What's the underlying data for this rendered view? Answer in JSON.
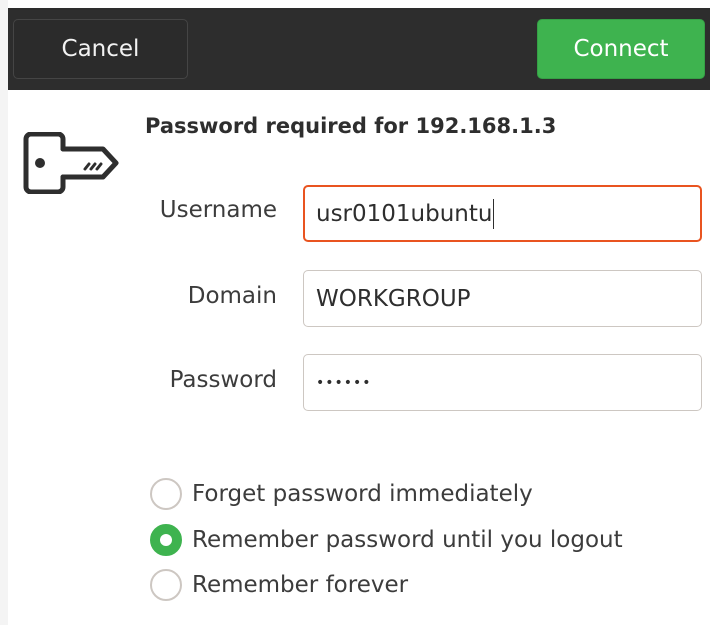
{
  "header": {
    "cancel_label": "Cancel",
    "connect_label": "Connect"
  },
  "dialog": {
    "title": "Password required for 192.168.1.3",
    "icon": "key-icon",
    "fields": {
      "username": {
        "label": "Username",
        "value": "usr0101ubuntu"
      },
      "domain": {
        "label": "Domain",
        "value": "WORKGROUP"
      },
      "password": {
        "label": "Password",
        "value": "••••••"
      }
    },
    "options": [
      {
        "label": "Forget password immediately",
        "checked": false
      },
      {
        "label": "Remember password until you logout",
        "checked": true
      },
      {
        "label": "Remember forever",
        "checked": false
      }
    ]
  },
  "colors": {
    "header_bg": "#2d2d2d",
    "accent_green": "#3eb34f",
    "focus_orange": "#e95420"
  }
}
